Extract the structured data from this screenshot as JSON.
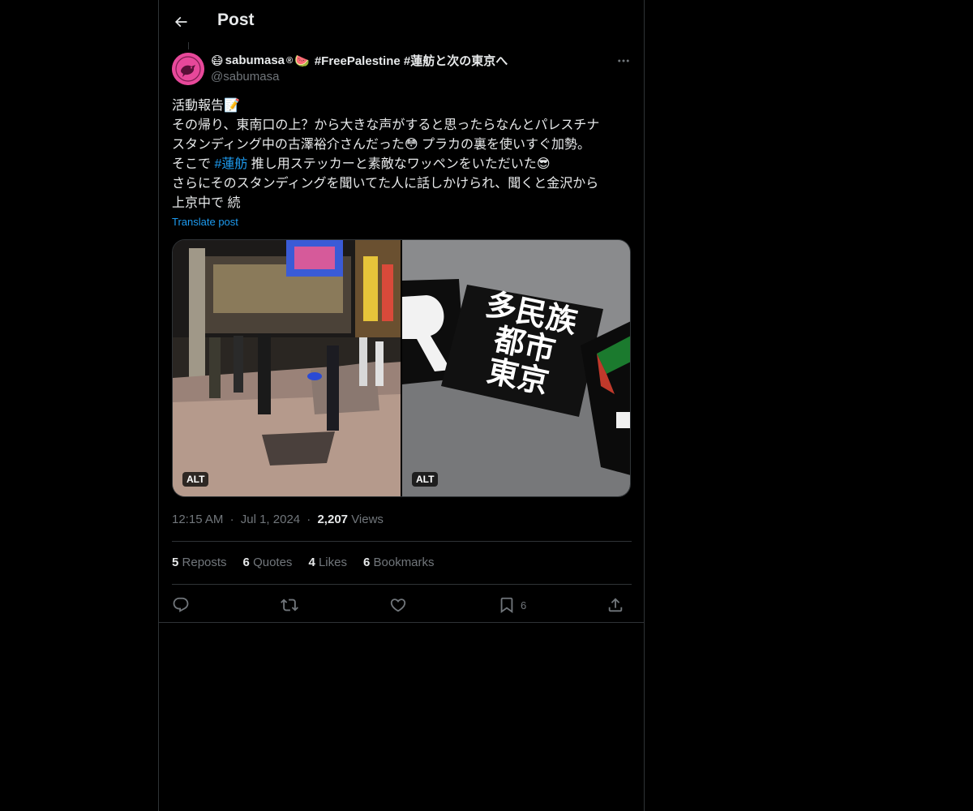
{
  "header": {
    "title": "Post"
  },
  "author": {
    "name_emoji_prefix": "😷",
    "name": "sabumasa",
    "name_suffix": "®",
    "name_emoji_suffix": "🍉",
    "name_tags": "#FreePalestine #蓮舫と次の東京へ",
    "handle": "@sabumasa"
  },
  "post": {
    "line1": "活動報告",
    "line1_emoji": "📝",
    "line2": "その帰り、東南口の上？から大きな声がすると思ったらなんとパレスチナ",
    "line3a": "スタンディング中の古澤裕介さんだった",
    "line3_emoji": "😳",
    "line3b": " プラカの裏を使いすぐ加勢。",
    "line4a": "そこで ",
    "line4_hashtag": "#蓮舫",
    "line4b": " 推し用ステッカーと素敵なワッペンをいただいた",
    "line4_emoji": "😎",
    "line5": "さらにそのスタンディングを聞いてた人に話しかけられ、聞くと金沢から",
    "line6": "上京中で 続",
    "translate": "Translate post"
  },
  "media": [
    {
      "alt": "ALT",
      "icon": "street-photo"
    },
    {
      "alt": "ALT",
      "icon": "sticker-photo",
      "sticker_text": [
        "多民族",
        "都市",
        "東京"
      ]
    }
  ],
  "meta": {
    "time": "12:15 AM",
    "sep1": "·",
    "date": "Jul 1, 2024",
    "sep2": "·",
    "views_count": "2,207",
    "views_label": "Views"
  },
  "stats": {
    "reposts_count": "5",
    "reposts_label": "Reposts",
    "quotes_count": "6",
    "quotes_label": "Quotes",
    "likes_count": "4",
    "likes_label": "Likes",
    "bookmarks_count": "6",
    "bookmarks_label": "Bookmarks"
  },
  "actions": {
    "bookmark_count": "6"
  },
  "colors": {
    "accent": "#1d9bf0",
    "muted": "#71767b",
    "text": "#e7e9ea",
    "border": "#2f3336",
    "background": "#000000"
  }
}
